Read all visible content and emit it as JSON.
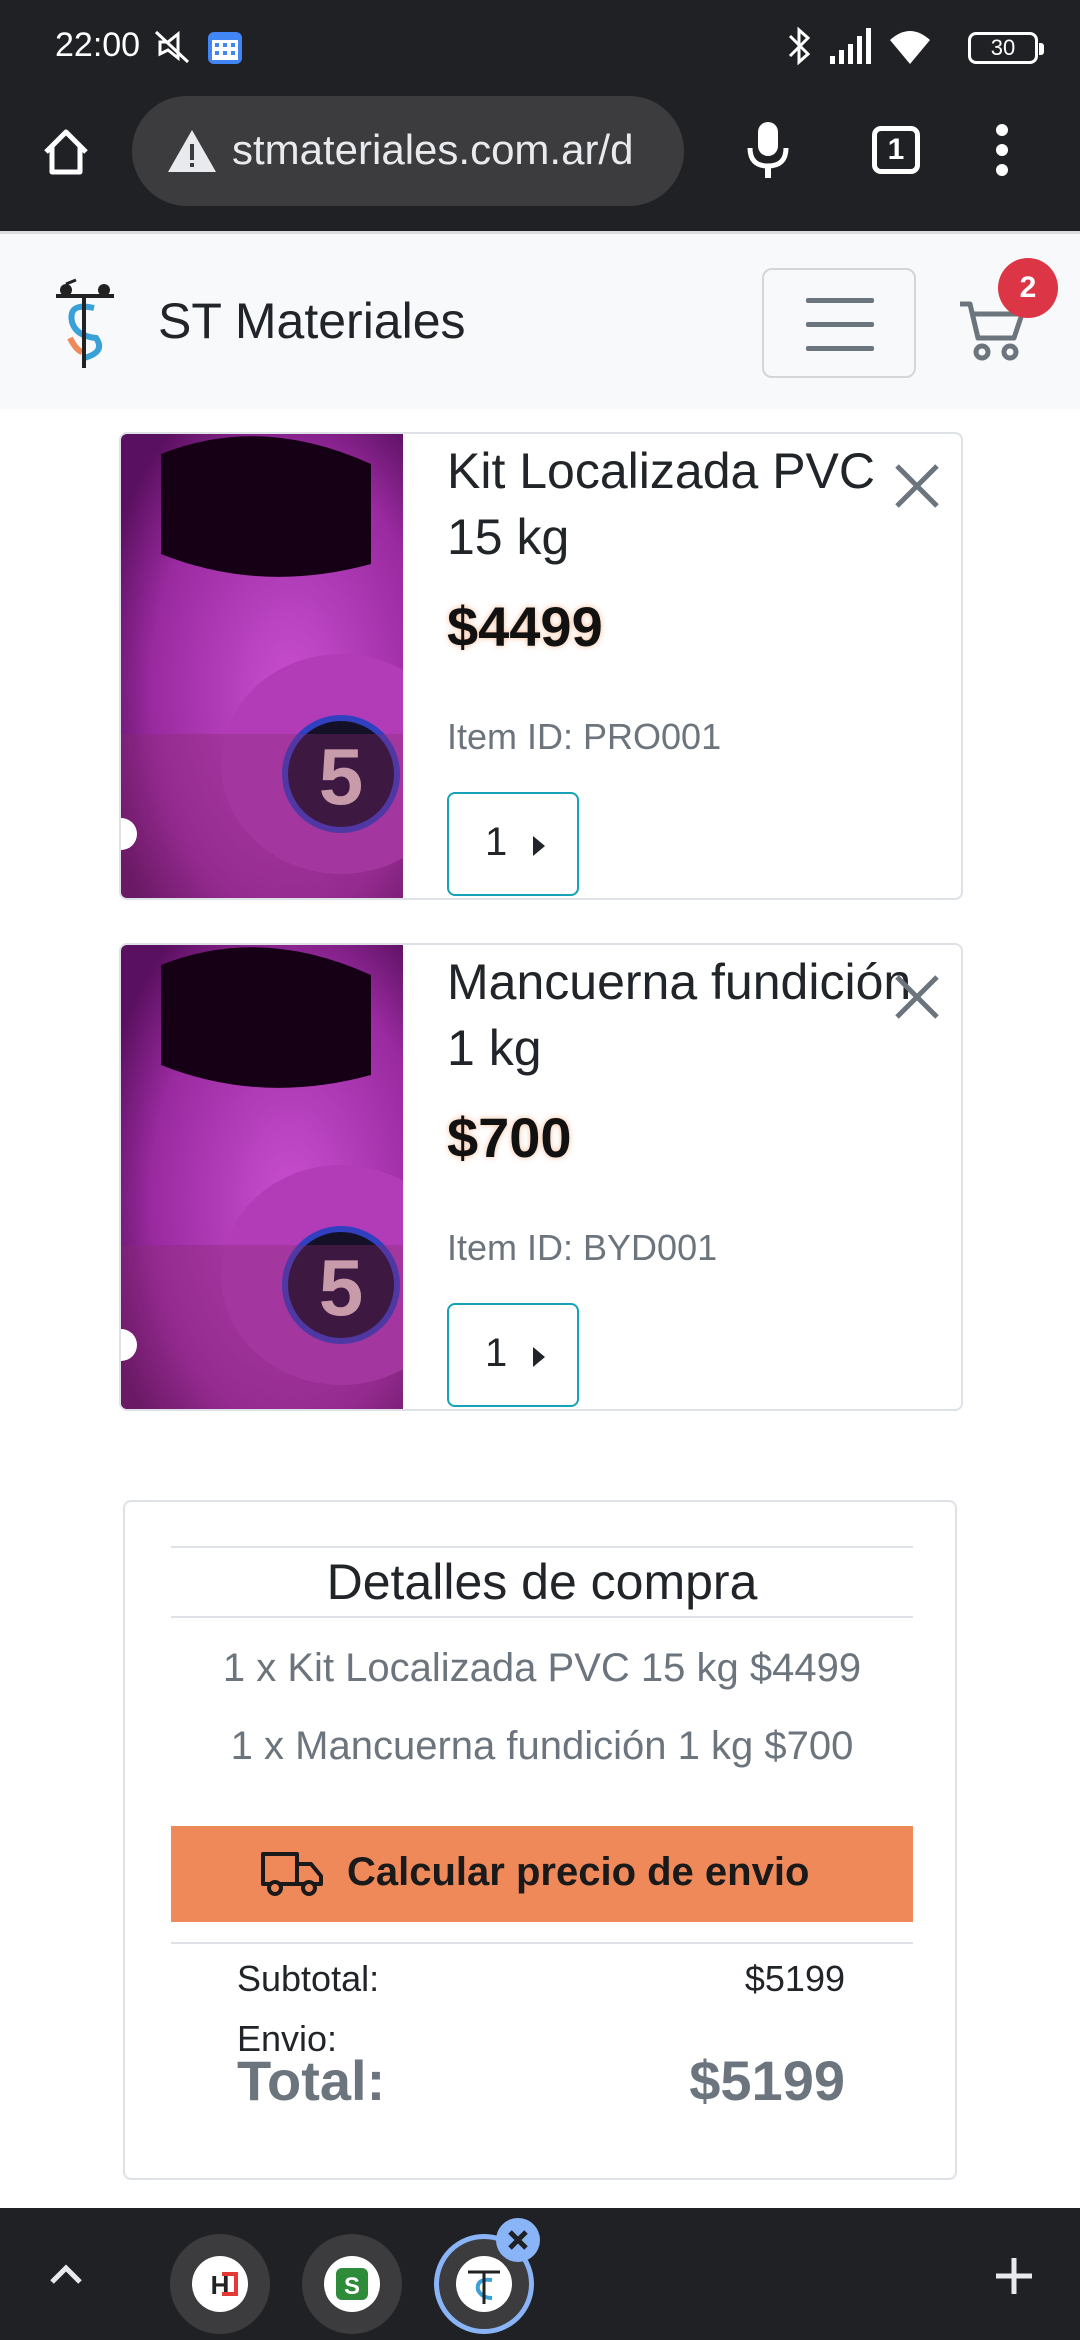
{
  "status_bar": {
    "time": "22:00",
    "battery": "30",
    "icons": [
      "mute-icon",
      "calendar-icon",
      "bluetooth-icon",
      "signal-icon",
      "wifi-icon",
      "battery-icon"
    ]
  },
  "browser": {
    "url": "stmateriales.com.ar/d",
    "tab_count": "1",
    "icons": [
      "home-icon",
      "warning-icon",
      "mic-icon",
      "tabs-icon",
      "more-icon"
    ]
  },
  "site": {
    "brand": "ST Materiales",
    "cart_count": "2"
  },
  "cart_items": [
    {
      "title": "Kit Localizada PVC 15 kg",
      "price": "$4499",
      "item_id": "Item ID: PRO001",
      "qty": "1"
    },
    {
      "title": "Mancuerna fundición 1 kg",
      "price": "$700",
      "item_id": "Item ID: BYD001",
      "qty": "1"
    }
  ],
  "summary": {
    "title": "Detalles de compra",
    "lines": [
      "1 x Kit Localizada PVC 15 kg  $4499",
      "1 x Mancuerna fundición 1 kg  $700"
    ],
    "ship_button": "Calcular precio de envio",
    "subtotal_label": "Subtotal:",
    "subtotal_value": "$5199",
    "envio_label": "Envio:",
    "total_label": "Total:",
    "total_value": "$5199"
  },
  "colors": {
    "accent_orange": "#f0895a",
    "qty_border": "#17a2b8",
    "badge_red": "#dc3545",
    "chrome_dark": "#202124"
  }
}
